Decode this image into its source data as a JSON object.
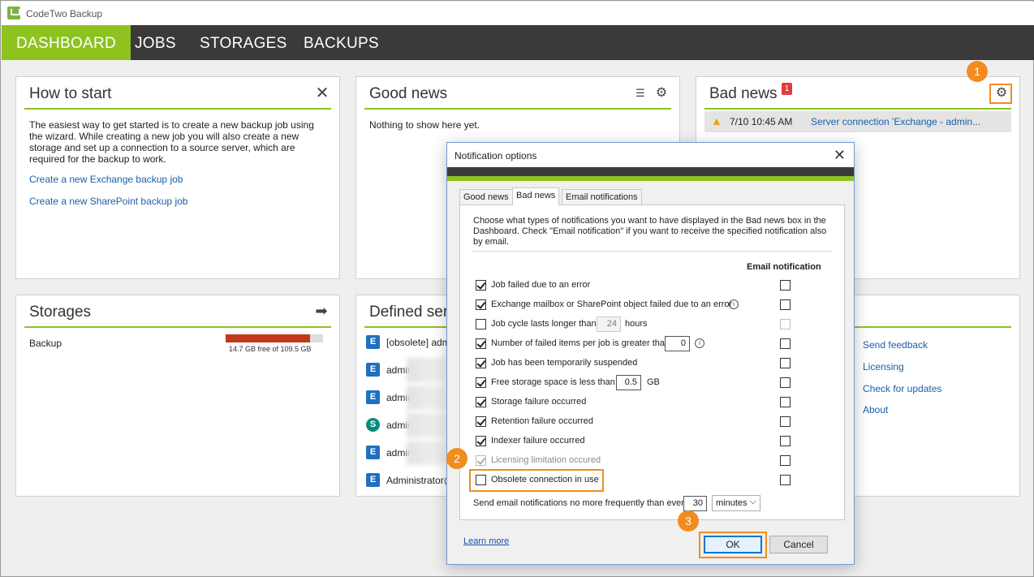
{
  "app": {
    "title": "CodeTwo Backup"
  },
  "nav": {
    "tabs": [
      {
        "label": "DASHBOARD",
        "active": true
      },
      {
        "label": "JOBS"
      },
      {
        "label": "STORAGES"
      },
      {
        "label": "BACKUPS"
      }
    ]
  },
  "how_to_start": {
    "title": "How to start",
    "text": "The easiest way to get started is to create a new backup job using the wizard. While creating a new job you will also create a new storage and set up a connection to a source server, which are required for the backup to work.",
    "links": [
      "Create a new Exchange backup job",
      "Create a new SharePoint backup job"
    ]
  },
  "good_news": {
    "title": "Good news",
    "empty_text": "Nothing to show here yet."
  },
  "bad_news": {
    "title": "Bad news",
    "badge": "1",
    "item": {
      "time": "7/10 10:45 AM",
      "message": "Server connection 'Exchange - admin..."
    }
  },
  "storages": {
    "title": "Storages",
    "items": [
      {
        "name": "Backup",
        "info": "14.7 GB free of 109.5 GB",
        "used_fraction": 0.866
      }
    ]
  },
  "defined_servers": {
    "title": "Defined serv",
    "items": [
      {
        "label": "[obsolete] adm",
        "icon": "E"
      },
      {
        "label": "admin@",
        "icon": "E"
      },
      {
        "label": "admin@",
        "icon": "E"
      },
      {
        "label": "admin@",
        "icon": "S"
      },
      {
        "label": "admin@",
        "icon": "E"
      },
      {
        "label": "Administrator@",
        "icon": "E"
      }
    ]
  },
  "help_links": [
    "Send feedback",
    "Licensing",
    "Check for updates",
    "About"
  ],
  "callouts": [
    "1",
    "2",
    "3"
  ],
  "dialog": {
    "title": "Notification options",
    "tabs": [
      "Good news",
      "Bad news",
      "Email notifications"
    ],
    "active_tab": "Bad news",
    "description": "Choose what types of notifications you want to have displayed in the Bad news box in the Dashboard. Check \"Email notification\" if you want to receive the specified notification also by email.",
    "email_header": "Email notification",
    "options": [
      {
        "label": "Job failed due to an error",
        "checked": true,
        "email": false
      },
      {
        "label": "Exchange mailbox or SharePoint object failed due to an error",
        "checked": true,
        "email": false
      },
      {
        "label": "Job cycle lasts longer than",
        "checked": false,
        "email": false,
        "value": "24",
        "suffix": "hours"
      },
      {
        "label": "Number of failed items per job is greater than",
        "checked": true,
        "email": false,
        "value": "0"
      },
      {
        "label": "Job has been temporarily suspended",
        "checked": true,
        "email": false
      },
      {
        "label": "Free storage space is less than",
        "checked": true,
        "email": false,
        "value": "0.5",
        "suffix": "GB"
      },
      {
        "label": "Storage failure occurred",
        "checked": true,
        "email": false
      },
      {
        "label": "Retention failure occurred",
        "checked": true,
        "email": false
      },
      {
        "label": "Indexer failure occurred",
        "checked": true,
        "email": false
      },
      {
        "label": "Licensing limitation occured",
        "checked": true,
        "email": false,
        "disabled": true
      },
      {
        "label": "Obsolete connection in use",
        "checked": false,
        "email": false
      }
    ],
    "frequency": {
      "label": "Send email notifications no more frequently than every",
      "value": "30",
      "unit": "minutes"
    },
    "learn_more": "Learn more",
    "ok": "OK",
    "cancel": "Cancel"
  }
}
